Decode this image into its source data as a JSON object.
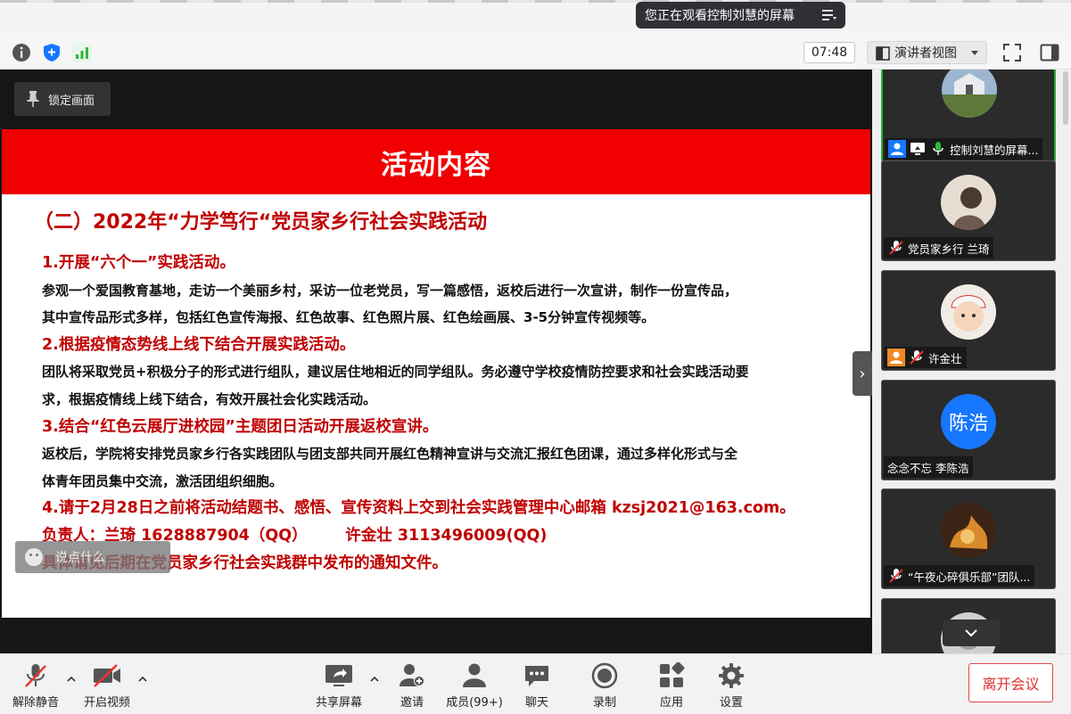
{
  "banner": {
    "text": "您正在观看控制刘慧的屏幕",
    "menu_icon": "menu-lines-icon"
  },
  "toolbar": {
    "timer": "07:48",
    "view_mode": "演讲者视图",
    "icons": [
      "info-icon",
      "shield-icon",
      "signal-icon",
      "speaker-view-icon",
      "fullscreen-icon",
      "sidebar-icon"
    ]
  },
  "stage": {
    "pin_label": "锁定画面",
    "chat_hint": "说点什么",
    "slide": {
      "title": "活动内容",
      "subtitle": "（二）2022年“力学笃行“党员家乡行社会实践活动",
      "lines": [
        {
          "style": "red",
          "text": "1.开展“六个一”实践活动。"
        },
        {
          "style": "black",
          "text": "参观一个爱国教育基地，走访一个美丽乡村，采访一位老党员，写一篇感悟，返校后进行一次宣讲，制作一份宣传品，"
        },
        {
          "style": "black",
          "text": "其中宣传品形式多样，包括红色宣传海报、红色故事、红色照片展、红色绘画展、3-5分钟宣传视频等。"
        },
        {
          "style": "red",
          "text": "2.根据疫情态势线上线下结合开展实践活动。"
        },
        {
          "style": "black",
          "text": "团队将采取党员+积极分子的形式进行组队，建议居住地相近的同学组队。务必遵守学校疫情防控要求和社会实践活动要"
        },
        {
          "style": "black",
          "text": "求，根据疫情线上线下结合，有效开展社会化实践活动。"
        },
        {
          "style": "red",
          "text": "3.结合“红色云展厅进校园”主题团日活动开展返校宣讲。"
        },
        {
          "style": "black",
          "text": "返校后，学院将安排党员家乡行各实践团队与团支部共同开展红色精神宣讲与交流汇报红色团课，通过多样化形式与全"
        },
        {
          "style": "black",
          "text": "体青年团员集中交流，激活团组织细胞。"
        },
        {
          "style": "red",
          "text": "4.请于2月28日之前将活动结题书、感悟、宣传资料上交到社会实践管理中心邮箱 kzsj2021@163.com。"
        },
        {
          "style": "red",
          "text": "负责人：兰琦 1628887904（QQ）       许金壮 3113496009(QQ)"
        },
        {
          "style": "red",
          "text": "具体请见后期在党员家乡行社会实践群中发布的通知文件。"
        }
      ]
    }
  },
  "participants": [
    {
      "label": "控制刘慧的屏幕...",
      "avatar": "landscape",
      "active": true,
      "icons": [
        "host-icon",
        "share-screen-icon",
        "mic-on-icon"
      ]
    },
    {
      "label": "党员家乡行 兰琦",
      "avatar": "person-photo",
      "active": false,
      "icons": [
        "mic-muted-icon"
      ]
    },
    {
      "label": "许金壮",
      "avatar": "child-photo",
      "active": false,
      "icons": [
        "host-icon",
        "mic-muted-icon"
      ]
    },
    {
      "label": "念念不忘 李陈浩",
      "avatar_text": "陈浩",
      "avatar": "text",
      "active": false,
      "icons": []
    },
    {
      "label": "“午夜心碎俱乐部”团队...",
      "avatar": "fire-art",
      "active": false,
      "icons": [
        "mic-muted-icon"
      ]
    },
    {
      "label": "",
      "avatar": "gray-photo",
      "active": false,
      "icons": []
    }
  ],
  "bottombar": {
    "unmute": "解除静音",
    "start_video": "开启视频",
    "share_screen": "共享屏幕",
    "invite": "邀请",
    "members": "成员(99+)",
    "chat": "聊天",
    "record": "录制",
    "apps": "应用",
    "settings": "设置",
    "leave": "离开会议"
  },
  "colors": {
    "slide_red": "#f00000",
    "text_red": "#c00000",
    "accent_blue": "#1677ff",
    "active_green": "#28b03a",
    "leave_red": "#e03030"
  }
}
